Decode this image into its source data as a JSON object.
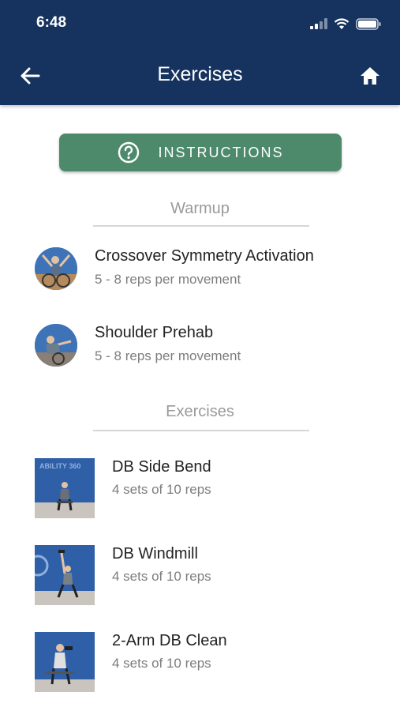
{
  "status_bar": {
    "time": "6:48"
  },
  "header": {
    "title": "Exercises"
  },
  "instructions": {
    "label": "INSTRUCTIONS"
  },
  "sections": {
    "warmup": {
      "title": "Warmup",
      "items": [
        {
          "title": "Crossover Symmetry Activation",
          "subtitle": "5 - 8 reps per movement"
        },
        {
          "title": "Shoulder Prehab",
          "subtitle": "5 - 8 reps per movement"
        }
      ]
    },
    "exercises": {
      "title": "Exercises",
      "items": [
        {
          "title": "DB Side Bend",
          "subtitle": "4 sets of 10 reps",
          "logo_text": "ABILITY 360"
        },
        {
          "title": "DB Windmill",
          "subtitle": "4 sets of 10 reps"
        },
        {
          "title": "2-Arm DB Clean",
          "subtitle": "4 sets of 10 reps"
        }
      ]
    }
  },
  "colors": {
    "header_bg": "#15335e",
    "button_bg": "#4d8a6c",
    "thumb_bg": "#2e5fa8"
  }
}
